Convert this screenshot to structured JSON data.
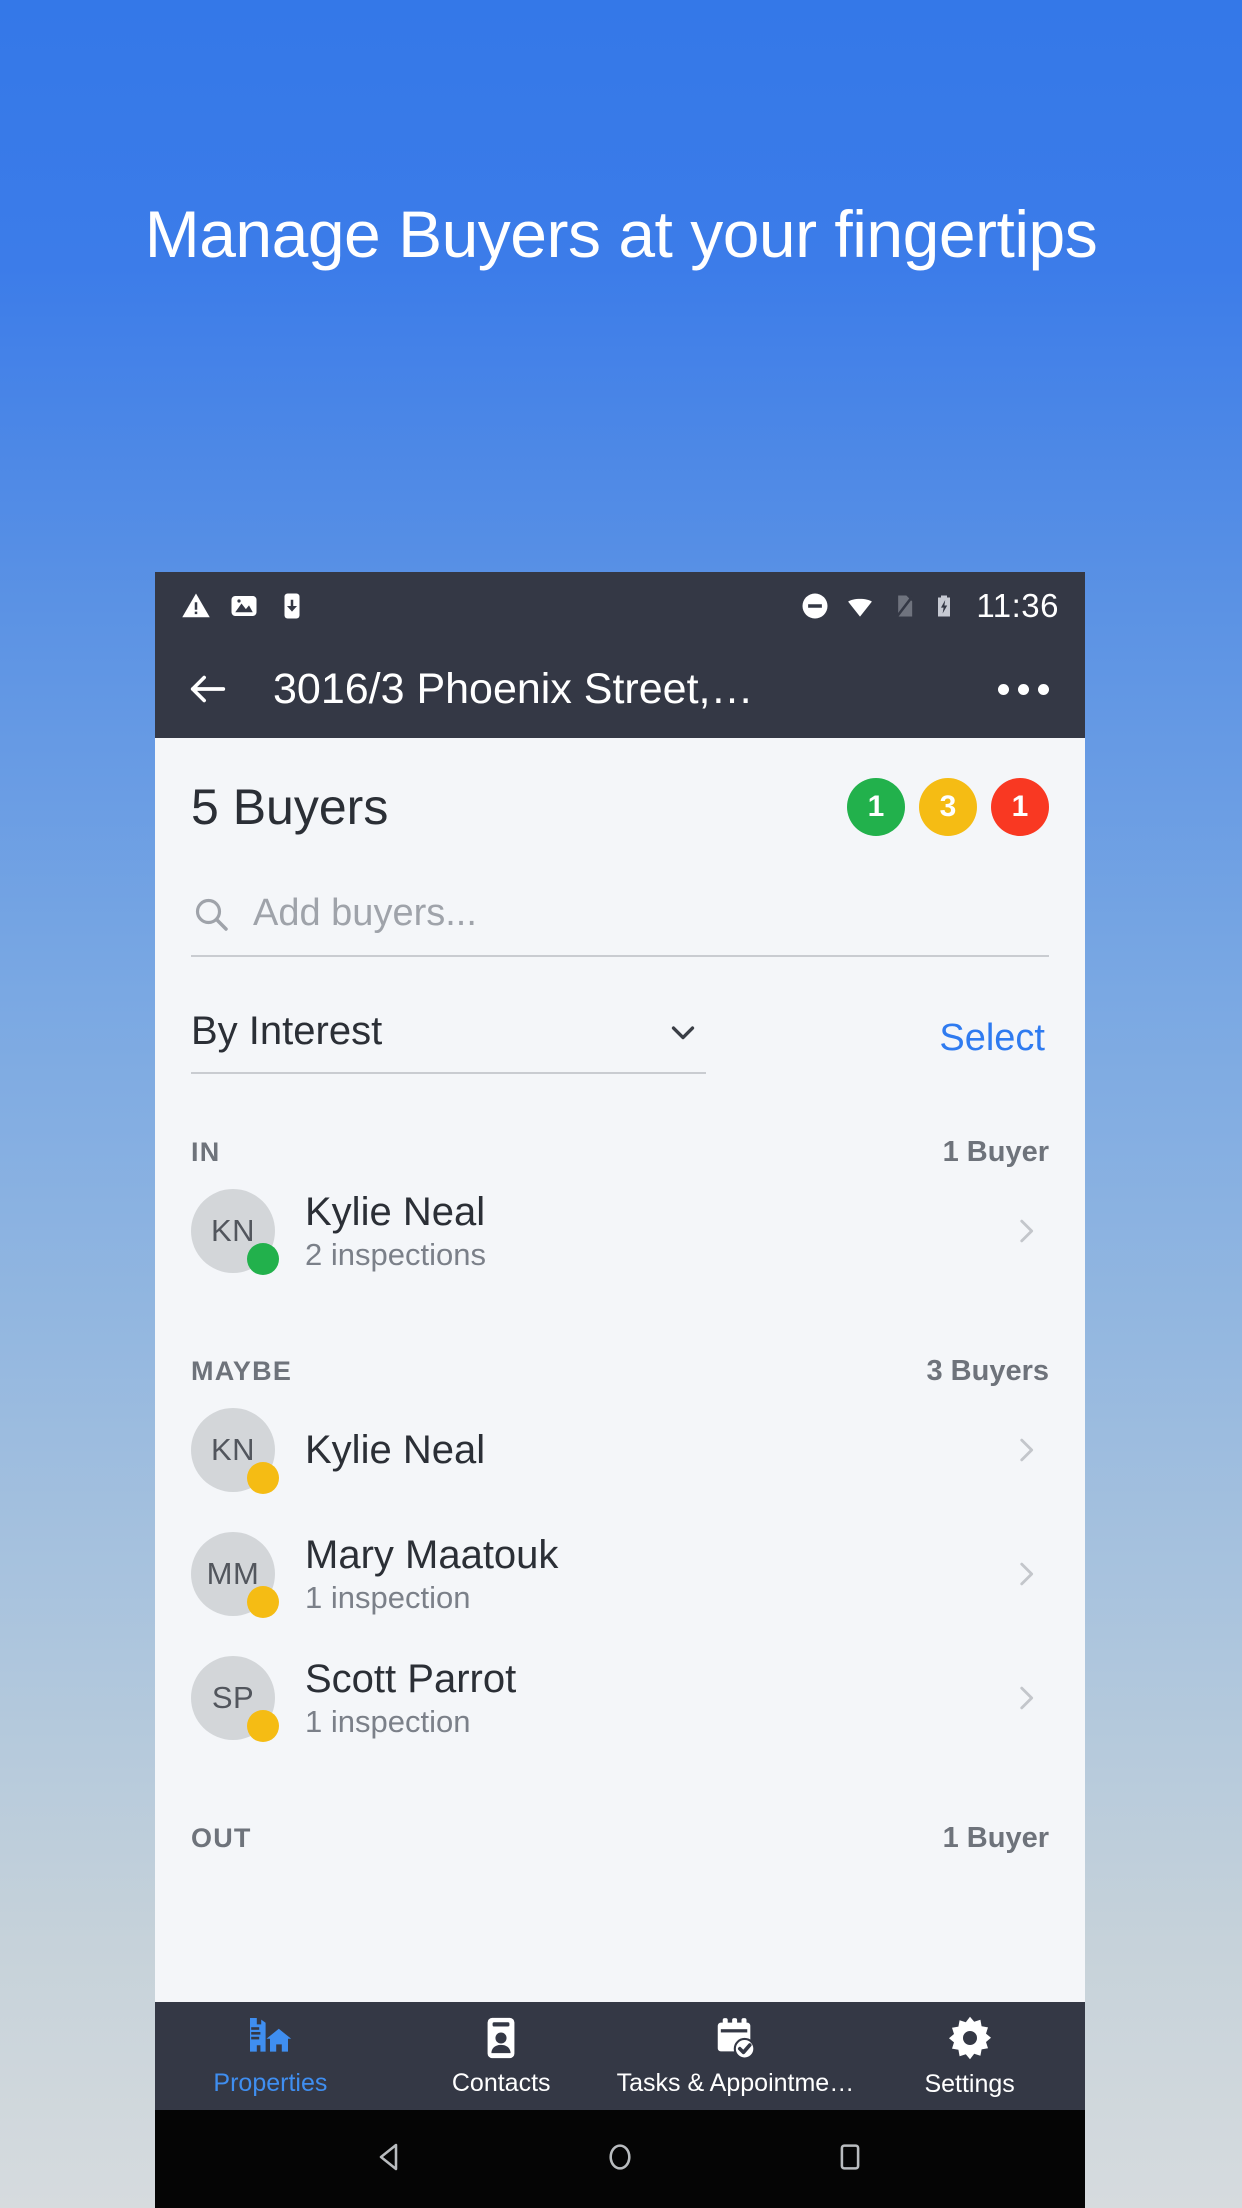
{
  "promo": {
    "headline": "Manage Buyers at your fingertips",
    "background_top": "#3478e8",
    "background_bottom": "#d6dbde"
  },
  "status_bar": {
    "time": "11:36",
    "icons": [
      "warning-icon",
      "image-icon",
      "app-install-icon",
      "do-not-disturb-icon",
      "wifi-icon",
      "no-sim-icon",
      "battery-charging-icon"
    ]
  },
  "app_bar": {
    "back_icon": "arrow-left-icon",
    "title": "3016/3 Phoenix Street,…",
    "overflow_icon": "more-vertical-icon"
  },
  "header": {
    "title": "5 Buyers",
    "badges": [
      {
        "value": "1",
        "color": "#22b14c",
        "name": "in-count-badge"
      },
      {
        "value": "3",
        "color": "#f5bc14",
        "name": "maybe-count-badge"
      },
      {
        "value": "1",
        "color": "#f93822",
        "name": "out-count-badge"
      }
    ]
  },
  "search": {
    "placeholder": "Add buyers...",
    "icon": "search-icon",
    "value": ""
  },
  "filter": {
    "selected": "By Interest",
    "chevron_icon": "chevron-down-icon",
    "select_label": "Select",
    "select_color": "#2f7bf0"
  },
  "sections": [
    {
      "name": "IN",
      "count": "1 Buyer",
      "dot_color": "#22b14c",
      "buyers": [
        {
          "initials": "KN",
          "name": "Kylie Neal",
          "sub": "2 inspections"
        }
      ]
    },
    {
      "name": "MAYBE",
      "count": "3 Buyers",
      "dot_color": "#f5bc14",
      "buyers": [
        {
          "initials": "KN",
          "name": "Kylie Neal",
          "sub": ""
        },
        {
          "initials": "MM",
          "name": "Mary Maatouk",
          "sub": "1 inspection"
        },
        {
          "initials": "SP",
          "name": "Scott Parrot",
          "sub": "1 inspection"
        }
      ]
    },
    {
      "name": "OUT",
      "count": "1 Buyer",
      "dot_color": "#f93822",
      "buyers": []
    }
  ],
  "bottom_nav": {
    "items": [
      {
        "label": "Properties",
        "icon": "properties-house-icon",
        "active": true
      },
      {
        "label": "Contacts",
        "icon": "contact-card-icon",
        "active": false
      },
      {
        "label": "Tasks & Appointme…",
        "icon": "calendar-check-icon",
        "active": false
      },
      {
        "label": "Settings",
        "icon": "gear-icon",
        "active": false
      }
    ],
    "active_color": "#3f8ef0"
  },
  "system_nav": {
    "back": "back-triangle-icon",
    "home": "home-circle-icon",
    "recents": "recents-square-icon"
  }
}
